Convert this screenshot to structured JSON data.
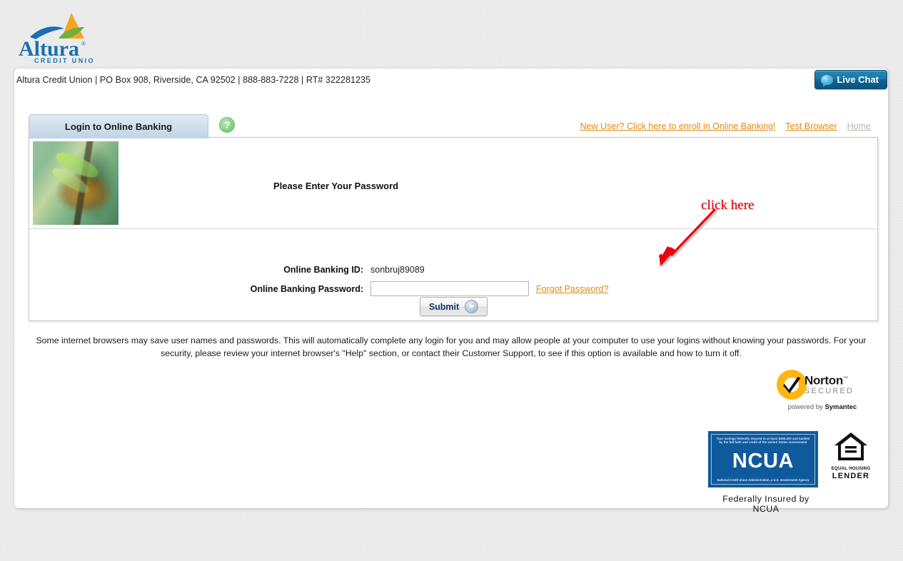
{
  "brand": {
    "name": "Altura",
    "tagline": "CREDIT UNION",
    "registered_mark": "®",
    "colors": {
      "blue": "#1a6fb4",
      "orange": "#f5a623",
      "green": "#7ab648",
      "link_orange": "#e08a14"
    }
  },
  "header": {
    "address_line": "Altura Credit Union | PO Box 908, Riverside, CA 92502 | 888-883-7228 | RT# 322281235",
    "live_chat_label": "Live Chat",
    "live_chat_icon": "chat-bubble-icon"
  },
  "tabs": [
    {
      "label": "Login to Online Banking",
      "active": true
    }
  ],
  "help": {
    "icon": "question-mark-icon",
    "glyph": "?"
  },
  "top_links": [
    {
      "label": "New User? Click here to enroll in Online Banking!",
      "muted": false
    },
    {
      "label": "Test Browser",
      "muted": false
    },
    {
      "label": "Home",
      "muted": true
    }
  ],
  "panel": {
    "security_image_alt": "security-image-insect",
    "prompt": "Please Enter Your Password",
    "fields": [
      {
        "label": "Online Banking ID:",
        "value": "sonbruj89089",
        "type": "text-readonly"
      },
      {
        "label": "Online Banking Password:",
        "value": "",
        "placeholder": "",
        "type": "password"
      }
    ],
    "forgot_link": "Forgot Password?",
    "submit_label": "Submit",
    "submit_icon": "arrow-right-circle-icon"
  },
  "annotation": {
    "text": "click here",
    "color": "#e8000b",
    "arrow_icon": "red-arrow-icon"
  },
  "disclaimer": "Some internet browsers may save user names and passwords. This will automatically complete any login for you and may allow people at your computer to use your logins without knowing your passwords. For your security, please review your internet browser's \"Help\" section, or contact their Customer Support, to see if this option is available and how to turn it off.",
  "norton": {
    "brand": "Norton",
    "tm": "™",
    "secured": "SECURED",
    "powered_prefix": "powered by ",
    "powered_brand": "Symantec",
    "icon": "norton-checkmark-icon"
  },
  "ncua": {
    "top_text": "Your savings federally insured to at least $250,000 and backed by the full faith and credit of the United States Government",
    "word": "NCUA",
    "bottom_text": "National Credit Union Administration, a U.S. Government Agency",
    "caption": "Federally Insured by NCUA",
    "equal_housing": {
      "icon": "equal-housing-icon",
      "line1": "EQUAL HOUSING",
      "line2": "LENDER"
    }
  }
}
